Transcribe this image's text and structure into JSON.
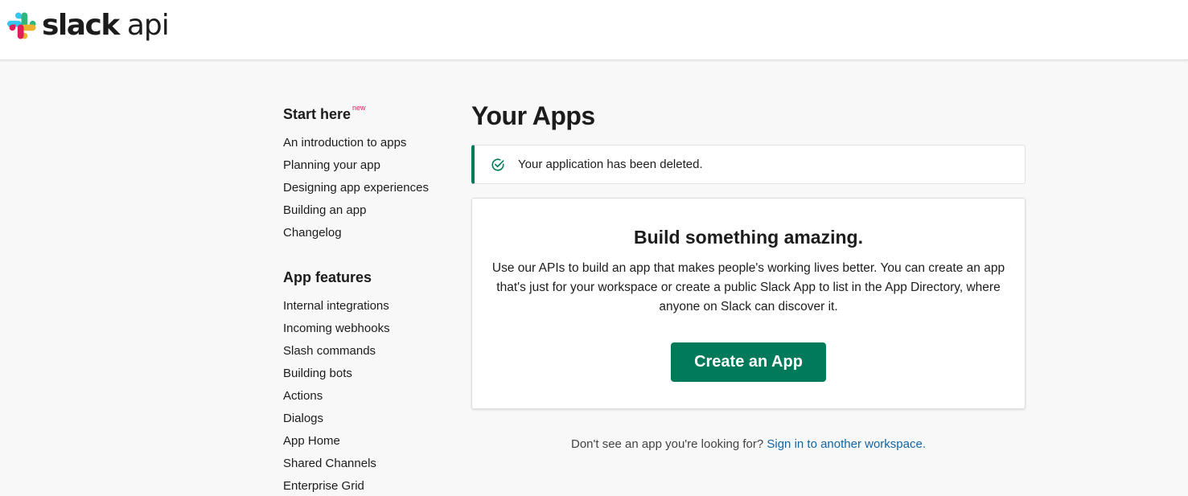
{
  "header": {
    "logo_slack": "slack",
    "logo_api": "api",
    "logo_icon": "slack-logo-icon"
  },
  "sidebar": {
    "start_heading": "Start here",
    "new_badge": "new",
    "start_items": [
      "An introduction to apps",
      "Planning your app",
      "Designing app experiences",
      "Building an app",
      "Changelog"
    ],
    "features_heading": "App features",
    "feature_items": [
      "Internal integrations",
      "Incoming webhooks",
      "Slash commands",
      "Building bots",
      "Actions",
      "Dialogs",
      "App Home",
      "Shared Channels",
      "Enterprise Grid"
    ]
  },
  "main": {
    "title": "Your Apps",
    "alert": {
      "text": "Your application has been deleted.",
      "icon": "check-circle-icon"
    },
    "card": {
      "title": "Build something amazing.",
      "body": "Use our APIs to build an app that makes people's working lives better. You can create an app that's just for your workspace or create a public Slack App to list in the App Directory, where anyone on Slack can discover it.",
      "button_label": "Create an App"
    },
    "footer": {
      "prompt": "Don't see an app you're looking for?",
      "link": "Sign in to another workspace."
    }
  },
  "colors": {
    "accent_green": "#007a5a",
    "link_blue": "#1264a3",
    "badge_red": "#e01e5a"
  }
}
